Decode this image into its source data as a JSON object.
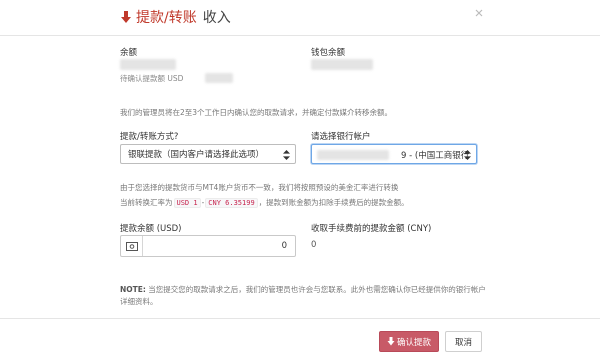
{
  "header": {
    "title": "提款/转账",
    "subtitle": "收入",
    "accent_color": "#c0392b",
    "icon": "arrow-down-icon",
    "close_icon": "close-icon"
  },
  "balances": {
    "balance_label": "余额",
    "pending_prefix": "待确认提款额",
    "pending_currency": "USD",
    "wallet_label": "钱包余额"
  },
  "processing_note": "我们的管理员将在2至3个工作日内确认您的取款请求，并确定付款媒介转移余额。",
  "method": {
    "label": "提款/转账方式?",
    "value": "银联提款（国内客户请选择此选项）"
  },
  "bank_account": {
    "label": "请选择银行帐户",
    "value_suffix": "9 - (中国工商银行"
  },
  "exchange": {
    "line1": "由于您选择的提款货币与MT4账户货币不一致，我们将按照预设的美金汇率进行转换",
    "line2_prefix": "当前转换汇率为",
    "from_code": "USD 1",
    "dash": "-",
    "to_code": "CNY 6.35199",
    "line2_suffix": "，提款到账金额为扣除手续费后的提款金额。"
  },
  "amount": {
    "label": "提款余额 (USD)",
    "value": "0",
    "icon": "money-icon"
  },
  "net": {
    "label": "收取手续费前的提款金额 (CNY)",
    "value": "0"
  },
  "note": {
    "prefix": "NOTE:",
    "text": "当您提交您的取款请求之后，我们的管理员也许会与您联系。此外也需您确认你已经提供你的银行帐户详细资料。"
  },
  "buttons": {
    "confirm": "确认提款",
    "confirm_color": "#c85a67",
    "cancel": "取消"
  }
}
